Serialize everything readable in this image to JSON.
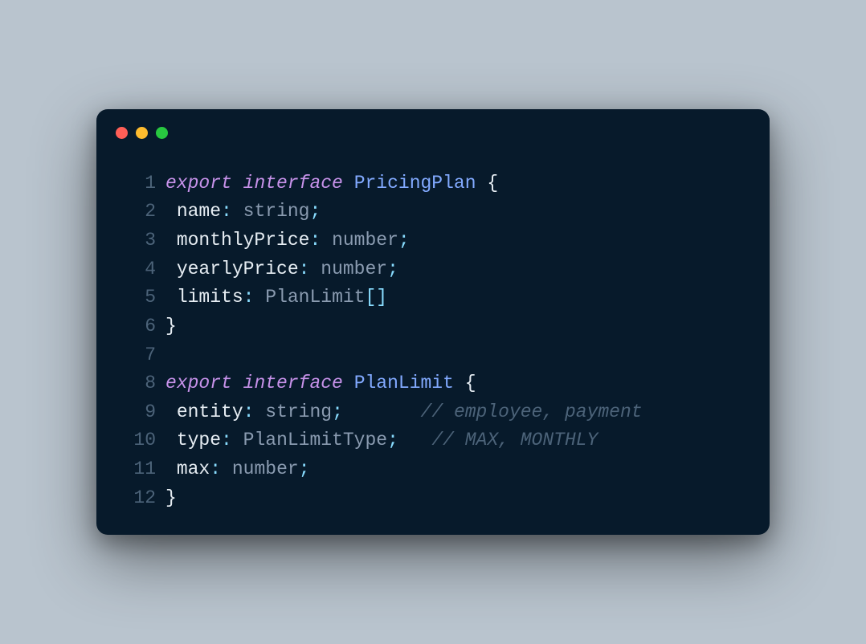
{
  "window": {
    "traffic_lights": [
      "red",
      "yellow",
      "green"
    ]
  },
  "code": {
    "lines": [
      {
        "num": "1",
        "tokens": [
          {
            "cls": "tok-keyword",
            "t": "export"
          },
          {
            "cls": "tok-default",
            "t": " "
          },
          {
            "cls": "tok-keyword",
            "t": "interface"
          },
          {
            "cls": "tok-default",
            "t": " "
          },
          {
            "cls": "tok-type",
            "t": "PricingPlan"
          },
          {
            "cls": "tok-default",
            "t": " "
          },
          {
            "cls": "tok-brace",
            "t": "{"
          }
        ]
      },
      {
        "num": "2",
        "tokens": [
          {
            "cls": "tok-default",
            "t": " "
          },
          {
            "cls": "tok-ident",
            "t": "name"
          },
          {
            "cls": "tok-punct",
            "t": ":"
          },
          {
            "cls": "tok-default",
            "t": " "
          },
          {
            "cls": "tok-builtin",
            "t": "string"
          },
          {
            "cls": "tok-punct",
            "t": ";"
          }
        ]
      },
      {
        "num": "3",
        "tokens": [
          {
            "cls": "tok-default",
            "t": " "
          },
          {
            "cls": "tok-ident",
            "t": "monthlyPrice"
          },
          {
            "cls": "tok-punct",
            "t": ":"
          },
          {
            "cls": "tok-default",
            "t": " "
          },
          {
            "cls": "tok-builtin",
            "t": "number"
          },
          {
            "cls": "tok-punct",
            "t": ";"
          }
        ]
      },
      {
        "num": "4",
        "tokens": [
          {
            "cls": "tok-default",
            "t": " "
          },
          {
            "cls": "tok-ident",
            "t": "yearlyPrice"
          },
          {
            "cls": "tok-punct",
            "t": ":"
          },
          {
            "cls": "tok-default",
            "t": " "
          },
          {
            "cls": "tok-builtin",
            "t": "number"
          },
          {
            "cls": "tok-punct",
            "t": ";"
          }
        ]
      },
      {
        "num": "5",
        "tokens": [
          {
            "cls": "tok-default",
            "t": " "
          },
          {
            "cls": "tok-ident",
            "t": "limits"
          },
          {
            "cls": "tok-punct",
            "t": ":"
          },
          {
            "cls": "tok-default",
            "t": " "
          },
          {
            "cls": "tok-builtin",
            "t": "PlanLimit"
          },
          {
            "cls": "tok-punct",
            "t": "[]"
          }
        ]
      },
      {
        "num": "6",
        "tokens": [
          {
            "cls": "tok-brace",
            "t": "}"
          }
        ]
      },
      {
        "num": "7",
        "tokens": [
          {
            "cls": "tok-default",
            "t": ""
          }
        ]
      },
      {
        "num": "8",
        "tokens": [
          {
            "cls": "tok-keyword",
            "t": "export"
          },
          {
            "cls": "tok-default",
            "t": " "
          },
          {
            "cls": "tok-keyword",
            "t": "interface"
          },
          {
            "cls": "tok-default",
            "t": " "
          },
          {
            "cls": "tok-type",
            "t": "PlanLimit"
          },
          {
            "cls": "tok-default",
            "t": " "
          },
          {
            "cls": "tok-brace",
            "t": "{"
          }
        ]
      },
      {
        "num": "9",
        "tokens": [
          {
            "cls": "tok-default",
            "t": " "
          },
          {
            "cls": "tok-ident",
            "t": "entity"
          },
          {
            "cls": "tok-punct",
            "t": ":"
          },
          {
            "cls": "tok-default",
            "t": " "
          },
          {
            "cls": "tok-builtin",
            "t": "string"
          },
          {
            "cls": "tok-punct",
            "t": ";"
          },
          {
            "cls": "tok-default",
            "t": "       "
          },
          {
            "cls": "tok-comment",
            "t": "// employee, payment"
          }
        ]
      },
      {
        "num": "10",
        "tokens": [
          {
            "cls": "tok-default",
            "t": " "
          },
          {
            "cls": "tok-ident",
            "t": "type"
          },
          {
            "cls": "tok-punct",
            "t": ":"
          },
          {
            "cls": "tok-default",
            "t": " "
          },
          {
            "cls": "tok-builtin",
            "t": "PlanLimitType"
          },
          {
            "cls": "tok-punct",
            "t": ";"
          },
          {
            "cls": "tok-default",
            "t": "   "
          },
          {
            "cls": "tok-comment",
            "t": "// MAX, MONTHLY"
          }
        ]
      },
      {
        "num": "11",
        "tokens": [
          {
            "cls": "tok-default",
            "t": " "
          },
          {
            "cls": "tok-ident",
            "t": "max"
          },
          {
            "cls": "tok-punct",
            "t": ":"
          },
          {
            "cls": "tok-default",
            "t": " "
          },
          {
            "cls": "tok-builtin",
            "t": "number"
          },
          {
            "cls": "tok-punct",
            "t": ";"
          }
        ]
      },
      {
        "num": "12",
        "tokens": [
          {
            "cls": "tok-brace",
            "t": "}"
          }
        ]
      }
    ]
  }
}
